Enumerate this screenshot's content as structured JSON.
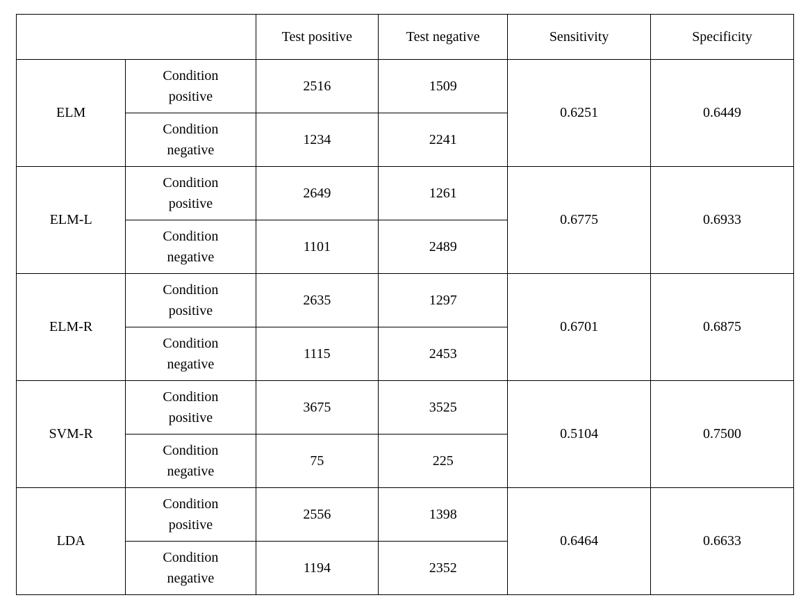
{
  "headers": {
    "test_positive": "Test positive",
    "test_negative": "Test negative",
    "sensitivity": "Sensitivity",
    "specificity": "Specificity"
  },
  "condition_labels": {
    "positive": "Condition\npositive",
    "negative": "Condition\nnegative"
  },
  "rows": [
    {
      "method": "ELM",
      "cp_tp": "2516",
      "cp_tn": "1509",
      "cn_tp": "1234",
      "cn_tn": "2241",
      "sensitivity": "0.6251",
      "specificity": "0.6449"
    },
    {
      "method": "ELM-L",
      "cp_tp": "2649",
      "cp_tn": "1261",
      "cn_tp": "1101",
      "cn_tn": "2489",
      "sensitivity": "0.6775",
      "specificity": "0.6933"
    },
    {
      "method": "ELM-R",
      "cp_tp": "2635",
      "cp_tn": "1297",
      "cn_tp": "1115",
      "cn_tn": "2453",
      "sensitivity": "0.6701",
      "specificity": "0.6875"
    },
    {
      "method": "SVM-R",
      "cp_tp": "3675",
      "cp_tn": "3525",
      "cn_tp": "75",
      "cn_tn": "225",
      "sensitivity": "0.5104",
      "specificity": "0.7500"
    },
    {
      "method": "LDA",
      "cp_tp": "2556",
      "cp_tn": "1398",
      "cn_tp": "1194",
      "cn_tn": "2352",
      "sensitivity": "0.6464",
      "specificity": "0.6633"
    }
  ]
}
